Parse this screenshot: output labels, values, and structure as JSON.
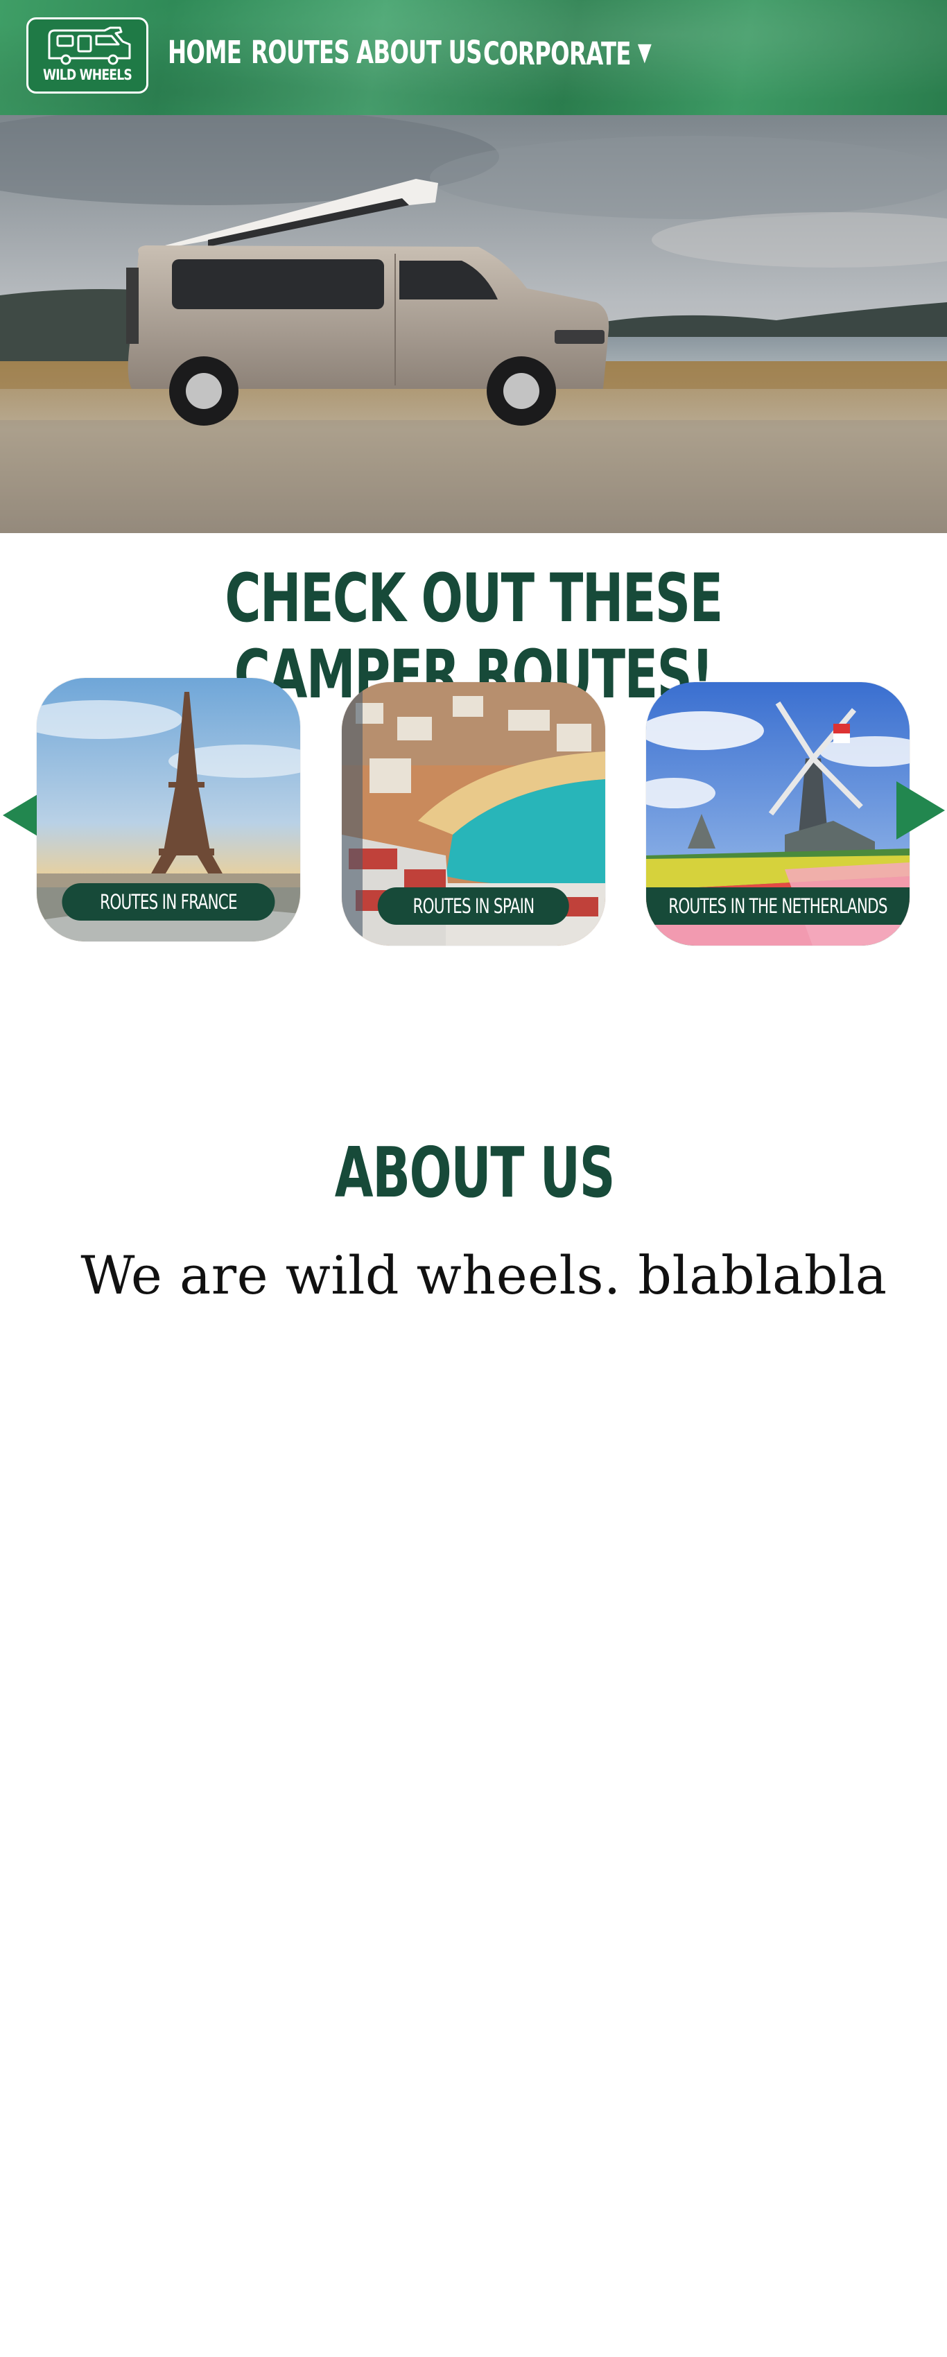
{
  "nav": {
    "logo_text": "WILD WHEELS",
    "items": [
      {
        "label": "HOME"
      },
      {
        "label": "ROUTES"
      },
      {
        "label": "ABOUT US"
      },
      {
        "label": "CORPORATE"
      }
    ],
    "dropdown_icon": "caret-down-icon",
    "accent": "#2f8a57"
  },
  "routes": {
    "title": "CHECK OUT THESE CAMPER ROUTES!",
    "prev_icon": "arrow-left-icon",
    "next_icon": "arrow-right-icon",
    "cards": [
      {
        "label": "ROUTES IN FRANCE"
      },
      {
        "label": "ROUTES IN SPAIN"
      },
      {
        "label": "ROUTES IN THE NETHERLANDS"
      }
    ],
    "accent": "#174a39"
  },
  "about": {
    "title": "ABOUT US",
    "text": "We are wild wheels. blablabla"
  }
}
